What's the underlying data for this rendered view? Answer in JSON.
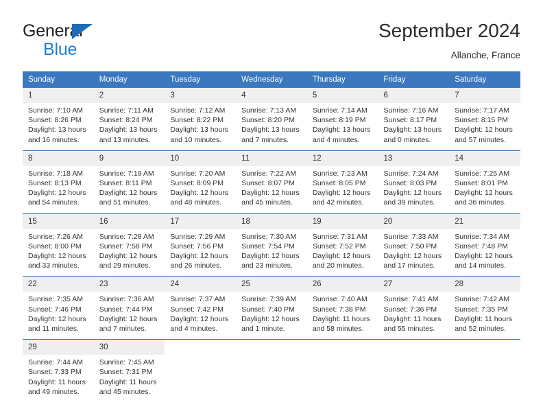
{
  "brand": {
    "line1": "General",
    "line2": "Blue",
    "accent_color": "#1c7ed6",
    "triangle_color": "#1c6cb6"
  },
  "header": {
    "title": "September 2024",
    "subtitle": "Allanche, France"
  },
  "theme": {
    "header_bg": "#3b78bf",
    "header_text": "#ffffff",
    "daynum_bg": "#efefef",
    "divider": "#3b78bf"
  },
  "calendar": {
    "weekday_headers": [
      "Sunday",
      "Monday",
      "Tuesday",
      "Wednesday",
      "Thursday",
      "Friday",
      "Saturday"
    ],
    "weeks": [
      [
        {
          "day": "1",
          "sunrise": "Sunrise: 7:10 AM",
          "sunset": "Sunset: 8:26 PM",
          "daylight1": "Daylight: 13 hours",
          "daylight2": "and 16 minutes."
        },
        {
          "day": "2",
          "sunrise": "Sunrise: 7:11 AM",
          "sunset": "Sunset: 8:24 PM",
          "daylight1": "Daylight: 13 hours",
          "daylight2": "and 13 minutes."
        },
        {
          "day": "3",
          "sunrise": "Sunrise: 7:12 AM",
          "sunset": "Sunset: 8:22 PM",
          "daylight1": "Daylight: 13 hours",
          "daylight2": "and 10 minutes."
        },
        {
          "day": "4",
          "sunrise": "Sunrise: 7:13 AM",
          "sunset": "Sunset: 8:20 PM",
          "daylight1": "Daylight: 13 hours",
          "daylight2": "and 7 minutes."
        },
        {
          "day": "5",
          "sunrise": "Sunrise: 7:14 AM",
          "sunset": "Sunset: 8:19 PM",
          "daylight1": "Daylight: 13 hours",
          "daylight2": "and 4 minutes."
        },
        {
          "day": "6",
          "sunrise": "Sunrise: 7:16 AM",
          "sunset": "Sunset: 8:17 PM",
          "daylight1": "Daylight: 13 hours",
          "daylight2": "and 0 minutes."
        },
        {
          "day": "7",
          "sunrise": "Sunrise: 7:17 AM",
          "sunset": "Sunset: 8:15 PM",
          "daylight1": "Daylight: 12 hours",
          "daylight2": "and 57 minutes."
        }
      ],
      [
        {
          "day": "8",
          "sunrise": "Sunrise: 7:18 AM",
          "sunset": "Sunset: 8:13 PM",
          "daylight1": "Daylight: 12 hours",
          "daylight2": "and 54 minutes."
        },
        {
          "day": "9",
          "sunrise": "Sunrise: 7:19 AM",
          "sunset": "Sunset: 8:11 PM",
          "daylight1": "Daylight: 12 hours",
          "daylight2": "and 51 minutes."
        },
        {
          "day": "10",
          "sunrise": "Sunrise: 7:20 AM",
          "sunset": "Sunset: 8:09 PM",
          "daylight1": "Daylight: 12 hours",
          "daylight2": "and 48 minutes."
        },
        {
          "day": "11",
          "sunrise": "Sunrise: 7:22 AM",
          "sunset": "Sunset: 8:07 PM",
          "daylight1": "Daylight: 12 hours",
          "daylight2": "and 45 minutes."
        },
        {
          "day": "12",
          "sunrise": "Sunrise: 7:23 AM",
          "sunset": "Sunset: 8:05 PM",
          "daylight1": "Daylight: 12 hours",
          "daylight2": "and 42 minutes."
        },
        {
          "day": "13",
          "sunrise": "Sunrise: 7:24 AM",
          "sunset": "Sunset: 8:03 PM",
          "daylight1": "Daylight: 12 hours",
          "daylight2": "and 39 minutes."
        },
        {
          "day": "14",
          "sunrise": "Sunrise: 7:25 AM",
          "sunset": "Sunset: 8:01 PM",
          "daylight1": "Daylight: 12 hours",
          "daylight2": "and 36 minutes."
        }
      ],
      [
        {
          "day": "15",
          "sunrise": "Sunrise: 7:26 AM",
          "sunset": "Sunset: 8:00 PM",
          "daylight1": "Daylight: 12 hours",
          "daylight2": "and 33 minutes."
        },
        {
          "day": "16",
          "sunrise": "Sunrise: 7:28 AM",
          "sunset": "Sunset: 7:58 PM",
          "daylight1": "Daylight: 12 hours",
          "daylight2": "and 29 minutes."
        },
        {
          "day": "17",
          "sunrise": "Sunrise: 7:29 AM",
          "sunset": "Sunset: 7:56 PM",
          "daylight1": "Daylight: 12 hours",
          "daylight2": "and 26 minutes."
        },
        {
          "day": "18",
          "sunrise": "Sunrise: 7:30 AM",
          "sunset": "Sunset: 7:54 PM",
          "daylight1": "Daylight: 12 hours",
          "daylight2": "and 23 minutes."
        },
        {
          "day": "19",
          "sunrise": "Sunrise: 7:31 AM",
          "sunset": "Sunset: 7:52 PM",
          "daylight1": "Daylight: 12 hours",
          "daylight2": "and 20 minutes."
        },
        {
          "day": "20",
          "sunrise": "Sunrise: 7:33 AM",
          "sunset": "Sunset: 7:50 PM",
          "daylight1": "Daylight: 12 hours",
          "daylight2": "and 17 minutes."
        },
        {
          "day": "21",
          "sunrise": "Sunrise: 7:34 AM",
          "sunset": "Sunset: 7:48 PM",
          "daylight1": "Daylight: 12 hours",
          "daylight2": "and 14 minutes."
        }
      ],
      [
        {
          "day": "22",
          "sunrise": "Sunrise: 7:35 AM",
          "sunset": "Sunset: 7:46 PM",
          "daylight1": "Daylight: 12 hours",
          "daylight2": "and 11 minutes."
        },
        {
          "day": "23",
          "sunrise": "Sunrise: 7:36 AM",
          "sunset": "Sunset: 7:44 PM",
          "daylight1": "Daylight: 12 hours",
          "daylight2": "and 7 minutes."
        },
        {
          "day": "24",
          "sunrise": "Sunrise: 7:37 AM",
          "sunset": "Sunset: 7:42 PM",
          "daylight1": "Daylight: 12 hours",
          "daylight2": "and 4 minutes."
        },
        {
          "day": "25",
          "sunrise": "Sunrise: 7:39 AM",
          "sunset": "Sunset: 7:40 PM",
          "daylight1": "Daylight: 12 hours",
          "daylight2": "and 1 minute."
        },
        {
          "day": "26",
          "sunrise": "Sunrise: 7:40 AM",
          "sunset": "Sunset: 7:38 PM",
          "daylight1": "Daylight: 11 hours",
          "daylight2": "and 58 minutes."
        },
        {
          "day": "27",
          "sunrise": "Sunrise: 7:41 AM",
          "sunset": "Sunset: 7:36 PM",
          "daylight1": "Daylight: 11 hours",
          "daylight2": "and 55 minutes."
        },
        {
          "day": "28",
          "sunrise": "Sunrise: 7:42 AM",
          "sunset": "Sunset: 7:35 PM",
          "daylight1": "Daylight: 11 hours",
          "daylight2": "and 52 minutes."
        }
      ],
      [
        {
          "day": "29",
          "sunrise": "Sunrise: 7:44 AM",
          "sunset": "Sunset: 7:33 PM",
          "daylight1": "Daylight: 11 hours",
          "daylight2": "and 49 minutes."
        },
        {
          "day": "30",
          "sunrise": "Sunrise: 7:45 AM",
          "sunset": "Sunset: 7:31 PM",
          "daylight1": "Daylight: 11 hours",
          "daylight2": "and 45 minutes."
        },
        {
          "day": "",
          "sunrise": "",
          "sunset": "",
          "daylight1": "",
          "daylight2": ""
        },
        {
          "day": "",
          "sunrise": "",
          "sunset": "",
          "daylight1": "",
          "daylight2": ""
        },
        {
          "day": "",
          "sunrise": "",
          "sunset": "",
          "daylight1": "",
          "daylight2": ""
        },
        {
          "day": "",
          "sunrise": "",
          "sunset": "",
          "daylight1": "",
          "daylight2": ""
        },
        {
          "day": "",
          "sunrise": "",
          "sunset": "",
          "daylight1": "",
          "daylight2": ""
        }
      ]
    ]
  }
}
